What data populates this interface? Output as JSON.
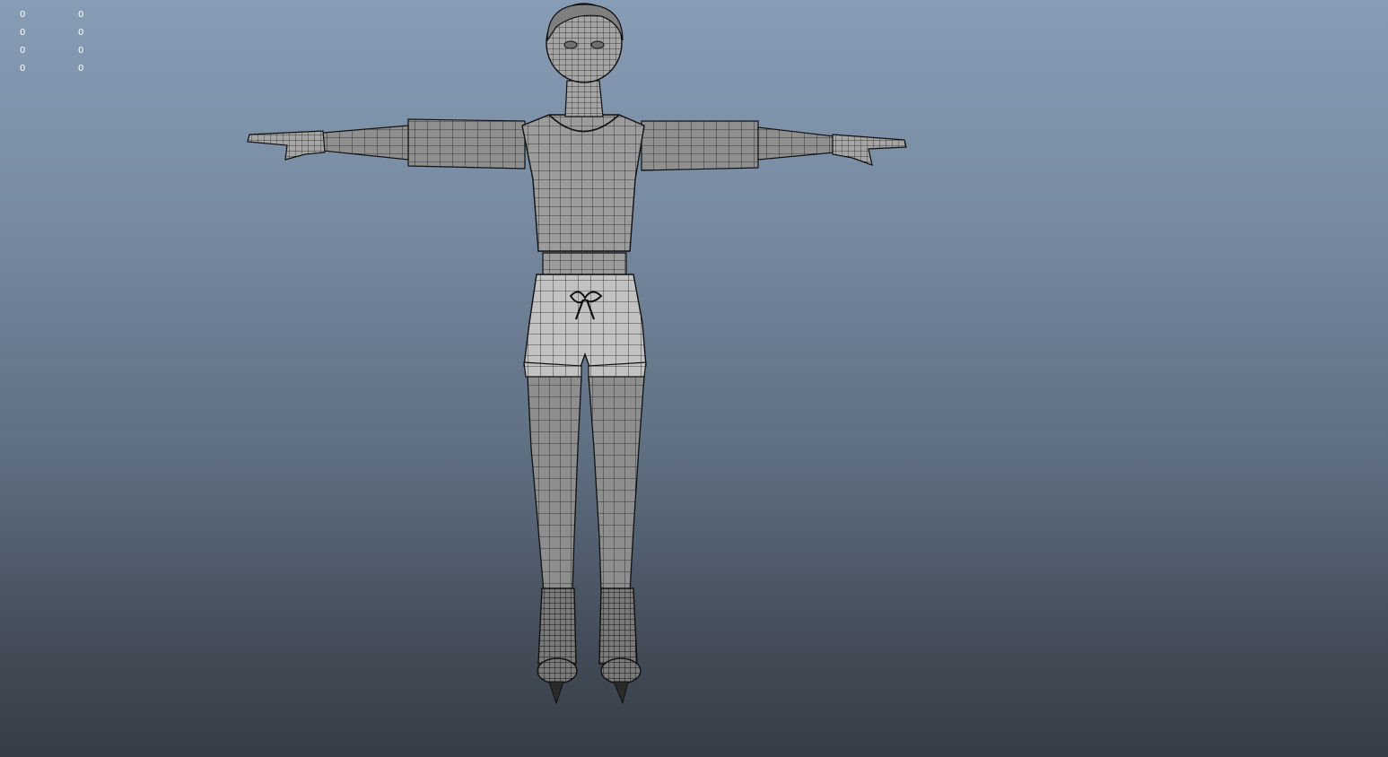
{
  "viewport": {
    "background_top": "#879db5",
    "background_bottom": "#363d46",
    "mesh_color": "#9a9a9a",
    "wire_color": "#1a1a1a"
  },
  "hud": {
    "rows": [
      {
        "a": "0",
        "b": "0"
      },
      {
        "a": "0",
        "b": "0"
      },
      {
        "a": "0",
        "b": "0"
      },
      {
        "a": "0",
        "b": "0"
      }
    ]
  },
  "model": {
    "icon": "character-wireframe-tpose"
  }
}
